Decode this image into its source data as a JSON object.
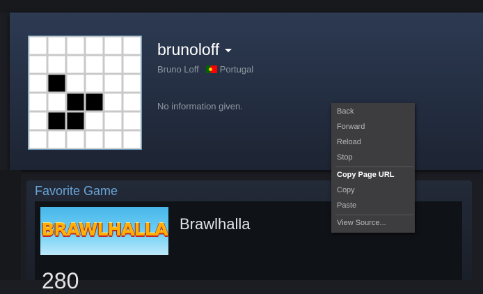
{
  "profile": {
    "persona_name": "brunoloff",
    "real_name": "Bruno Loff",
    "country": "Portugal",
    "summary": "No information given.",
    "avatar_pixels": [
      [
        0,
        0,
        0,
        0,
        0,
        0
      ],
      [
        0,
        0,
        0,
        0,
        0,
        0
      ],
      [
        0,
        1,
        0,
        0,
        0,
        0
      ],
      [
        0,
        0,
        1,
        1,
        0,
        0
      ],
      [
        0,
        1,
        1,
        0,
        0,
        0
      ],
      [
        0,
        0,
        0,
        0,
        0,
        0
      ]
    ]
  },
  "favorite_game": {
    "section_title": "Favorite Game",
    "banner_text": "BRAWLHALLA",
    "name": "Brawlhalla",
    "hours_partial": "280"
  },
  "context_menu": {
    "items": [
      "Back",
      "Forward",
      "Reload",
      "Stop",
      "Copy Page URL",
      "Copy",
      "Paste",
      "View Source..."
    ]
  },
  "colors": {
    "accent_blue": "#6aa4d6",
    "menu_bg": "#3d3d3f"
  }
}
